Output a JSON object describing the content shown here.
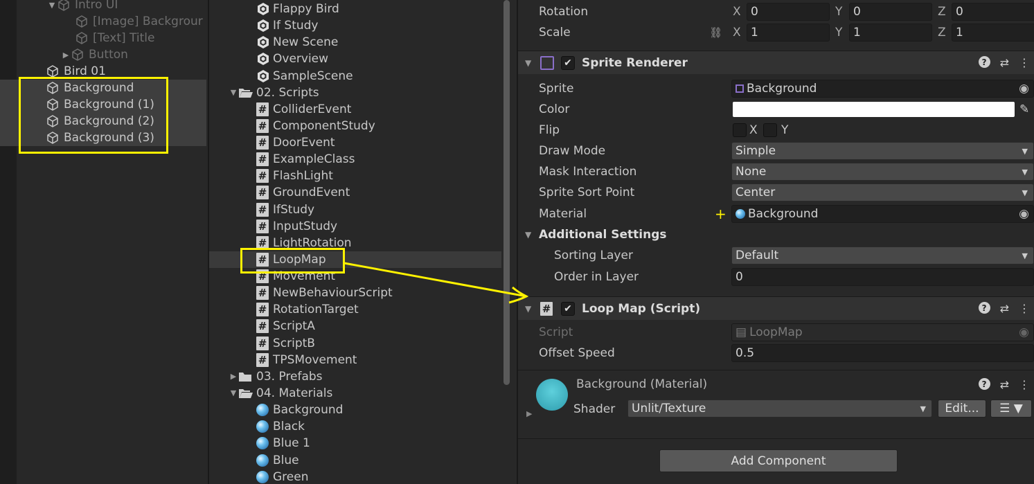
{
  "hierarchy": {
    "items": [
      {
        "label": "Intro UI",
        "dim": true
      },
      {
        "label": "[Image] Backgrour",
        "dim": true
      },
      {
        "label": "[Text] Title",
        "dim": true
      },
      {
        "label": "Button",
        "dim": true
      },
      {
        "label": "Bird 01",
        "dim": false
      },
      {
        "label": "Background",
        "dim": false
      },
      {
        "label": "Background (1)",
        "dim": false
      },
      {
        "label": "Background (2)",
        "dim": false
      },
      {
        "label": "Background (3)",
        "dim": false
      }
    ]
  },
  "project": {
    "scenes": [
      "Flappy Bird",
      "If Study",
      "New Scene",
      "Overview",
      "SampleScene"
    ],
    "scripts_folder": "02. Scripts",
    "scripts": [
      "ColliderEvent",
      "ComponentStudy",
      "DoorEvent",
      "ExampleClass",
      "FlashLight",
      "GroundEvent",
      "IfStudy",
      "InputStudy",
      "LightRotation",
      "LoopMap",
      "Movement",
      "NewBehaviourScript",
      "RotationTarget",
      "ScriptA",
      "ScriptB",
      "TPSMovement"
    ],
    "prefabs_folder": "03. Prefabs",
    "materials_folder": "04. Materials",
    "materials": [
      "Background",
      "Black",
      "Blue 1",
      "Blue",
      "Green"
    ]
  },
  "inspector": {
    "transform": {
      "rotation_label": "Rotation",
      "scale_label": "Scale",
      "axis_x": "X",
      "axis_y": "Y",
      "axis_z": "Z",
      "rotation": {
        "x": "0",
        "y": "0",
        "z": "0"
      },
      "scale": {
        "x": "1",
        "y": "1",
        "z": "1"
      }
    },
    "sprite_renderer": {
      "title": "Sprite Renderer",
      "sprite_label": "Sprite",
      "sprite_value": "Background",
      "color_label": "Color",
      "color_value": "#ffffff",
      "flip_label": "Flip",
      "flip_x": "X",
      "flip_y": "Y",
      "draw_mode_label": "Draw Mode",
      "draw_mode_value": "Simple",
      "mask_label": "Mask Interaction",
      "mask_value": "None",
      "sort_point_label": "Sprite Sort Point",
      "sort_point_value": "Center",
      "material_label": "Material",
      "material_value": "Background",
      "additional_label": "Additional Settings",
      "sorting_layer_label": "Sorting Layer",
      "sorting_layer_value": "Default",
      "order_label": "Order in Layer",
      "order_value": "0"
    },
    "loop_map": {
      "title": "Loop Map (Script)",
      "script_label": "Script",
      "script_value": "LoopMap",
      "offset_label": "Offset Speed",
      "offset_value": "0.5"
    },
    "material": {
      "title": "Background (Material)",
      "shader_label": "Shader",
      "shader_value": "Unlit/Texture",
      "edit_label": "Edit..."
    },
    "add_component_label": "Add Component"
  },
  "colors": {
    "highlight": "#fff200",
    "accent": "#4a90c8"
  }
}
